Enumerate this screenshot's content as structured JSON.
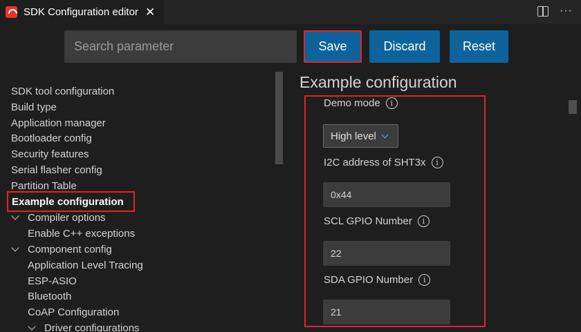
{
  "tab": {
    "title": "SDK Configuration editor",
    "close_glyph": "✕",
    "logo_icon": "espressif-logo-icon",
    "actions": [
      "split-editor-icon",
      "more-actions-icon"
    ],
    "more_glyph": "···"
  },
  "toolbar": {
    "search_placeholder": "Search parameter",
    "save_label": "Save",
    "discard_label": "Discard",
    "reset_label": "Reset"
  },
  "sidebar": {
    "items": [
      {
        "label": "SDK tool configuration"
      },
      {
        "label": "Build type"
      },
      {
        "label": "Application manager"
      },
      {
        "label": "Bootloader config"
      },
      {
        "label": "Security features"
      },
      {
        "label": "Serial flasher config"
      },
      {
        "label": "Partition Table"
      },
      {
        "label": "Example configuration",
        "selected": true
      },
      {
        "label": "Compiler options",
        "expanded": true
      },
      {
        "label": "Enable C++ exceptions"
      },
      {
        "label": "Component config",
        "expanded": true
      },
      {
        "label": "Application Level Tracing"
      },
      {
        "label": "ESP-ASIO"
      },
      {
        "label": "Bluetooth"
      },
      {
        "label": "CoAP Configuration"
      },
      {
        "label": "Driver configurations",
        "expanded": true
      }
    ]
  },
  "main": {
    "section_title": "Example configuration",
    "fields": {
      "demo_mode": {
        "label": "Demo mode",
        "value": "High level"
      },
      "i2c_address": {
        "label": "I2C address of SHT3x",
        "value": "0x44"
      },
      "scl_gpio": {
        "label": "SCL GPIO Number",
        "value": "22"
      },
      "sda_gpio": {
        "label": "SDA GPIO Number",
        "value": "21"
      }
    },
    "info_glyph": "i"
  },
  "colors": {
    "accent_button": "#0e639c",
    "highlight": "#e0242b",
    "background": "#1e1e1e",
    "input_bg": "#3c3c3c"
  }
}
